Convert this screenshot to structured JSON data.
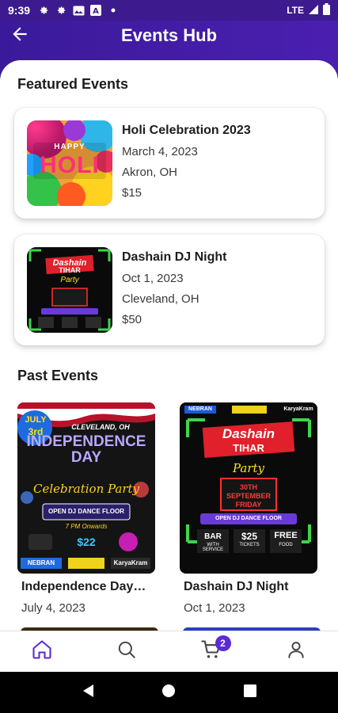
{
  "status_bar": {
    "time": "9:39",
    "network": "LTE",
    "icons": [
      "gear-icon",
      "gear-icon",
      "image-icon",
      "a-icon",
      "dot-icon",
      "signal-icon",
      "battery-icon"
    ]
  },
  "header": {
    "title": "Events Hub",
    "back_icon": "arrow-left-icon"
  },
  "featured": {
    "section_title": "Featured Events",
    "items": [
      {
        "name": "Holi Celebration 2023",
        "date": "March 4, 2023",
        "location": "Akron, OH",
        "price": "$15",
        "poster_text": [
          "HAPPY",
          "HOLI"
        ]
      },
      {
        "name": "Dashain DJ Night",
        "date": "Oct 1, 2023",
        "location": "Cleveland, OH",
        "price": "$50",
        "poster_text": [
          "Dashain",
          "TIHAR",
          "Party"
        ]
      }
    ]
  },
  "past": {
    "section_title": "Past Events",
    "items": [
      {
        "name": "Independence Day…",
        "date": "July 4, 2023",
        "poster_text": [
          "JULY",
          "3rd",
          "CLEVELAND, OH",
          "INDEPENDENCE DAY",
          "Celebration Party",
          "OPEN DJ DANCE FLOOR",
          "7 PM Onwards",
          "$22",
          "NEBRAN",
          "KaryaKram"
        ]
      },
      {
        "name": "Dashain DJ Night",
        "date": "Oct 1, 2023",
        "poster_text": [
          "NEBRAN",
          "Dashain",
          "TIHAR",
          "Party",
          "30TH SEPTEMBER FRIDAY",
          "OPEN DJ DANCE FLOOR",
          "BAR",
          "WITH SERVICE",
          "$25",
          "TICKETS",
          "FREE",
          "FOOD",
          "KaryaKram"
        ]
      }
    ]
  },
  "bottom_nav": {
    "items": [
      "home-icon",
      "search-icon",
      "cart-icon",
      "profile-icon"
    ],
    "active": "home-icon",
    "cart_badge": "2"
  },
  "colors": {
    "header": "#4a1fb0",
    "accent": "#5b2bd6",
    "badge": "#5b2bd6"
  }
}
